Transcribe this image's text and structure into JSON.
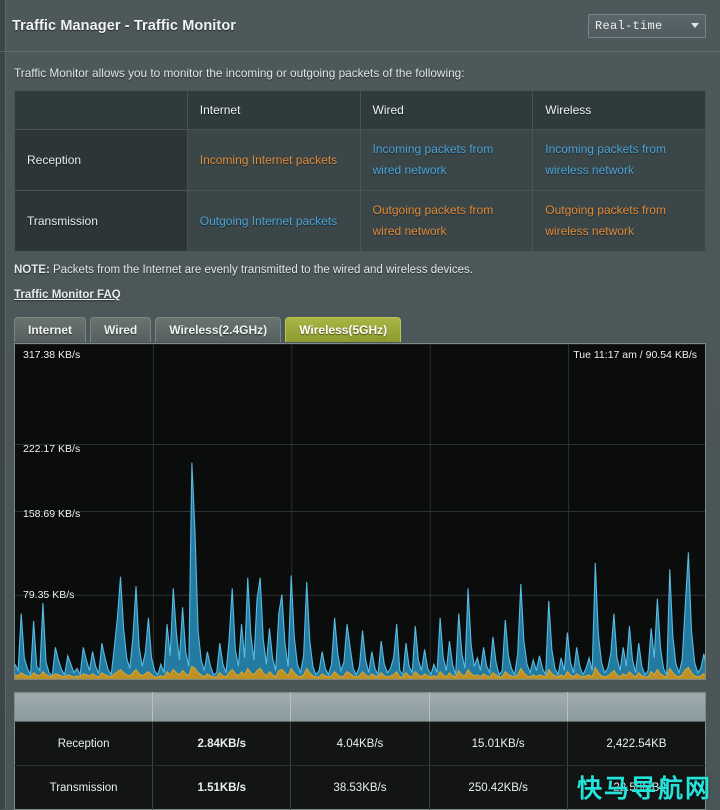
{
  "header": {
    "title": "Traffic Manager - Traffic Monitor",
    "dropdown_value": "Real-time",
    "dropdown_icon": "chevron-down-icon"
  },
  "intro": "Traffic Monitor allows you to monitor the incoming or outgoing packets of the following:",
  "info_table": {
    "columns": [
      "",
      "Internet",
      "Wired",
      "Wireless"
    ],
    "rows": [
      {
        "label": "Reception",
        "cells": [
          {
            "text": "Incoming Internet packets",
            "color": "#e08b39"
          },
          {
            "text": "Incoming packets from wired network",
            "color": "#4ba3d8"
          },
          {
            "text": "Incoming packets from wireless network",
            "color": "#4ba3d8"
          }
        ]
      },
      {
        "label": "Transmission",
        "cells": [
          {
            "text": "Outgoing Internet packets",
            "color": "#4ba3d8"
          },
          {
            "text": "Outgoing packets from wired network",
            "color": "#e08b39"
          },
          {
            "text": "Outgoing packets from wireless network",
            "color": "#e08b39"
          }
        ]
      }
    ]
  },
  "note": {
    "prefix": "NOTE:",
    "text": " Packets from the Internet are evenly transmitted to the wired and wireless devices."
  },
  "faq_link": "Traffic Monitor FAQ",
  "tabs": [
    {
      "label": "Internet",
      "active": false
    },
    {
      "label": "Wired",
      "active": false
    },
    {
      "label": "Wireless(2.4GHz)",
      "active": false
    },
    {
      "label": "Wireless(5GHz)",
      "active": true
    }
  ],
  "chart_data": {
    "type": "area",
    "title": "",
    "status_text": "Tue 11:17 am / 90.54 KB/s",
    "ylabel": "KB/s",
    "xlabel": "",
    "grid": true,
    "legend_position": "none",
    "ylim": [
      0,
      317.38
    ],
    "y_ticks": [
      "317.38 KB/s",
      "222.17 KB/s",
      "158.69 KB/s",
      "79.35 KB/s"
    ],
    "y_tick_values": [
      317.38,
      222.17,
      158.69,
      79.35
    ],
    "vertical_gridlines": 4,
    "colors": {
      "reception_fill": "#2682ab",
      "reception_stroke": "#5fc8ef",
      "transmission_fill": "#c8921f",
      "transmission_stroke": "#e0ad3a",
      "background": "#0b0c0c",
      "gridline": "#2d3132"
    },
    "series": [
      {
        "name": "Reception",
        "color": "#2682ab",
        "values": [
          14,
          8,
          62,
          20,
          10,
          4,
          55,
          12,
          8,
          72,
          16,
          6,
          3,
          30,
          18,
          9,
          4,
          22,
          14,
          6,
          10,
          4,
          30,
          18,
          8,
          26,
          12,
          5,
          34,
          20,
          9,
          4,
          30,
          58,
          97,
          48,
          20,
          10,
          40,
          88,
          30,
          12,
          25,
          58,
          20,
          8,
          4,
          14,
          6,
          52,
          22,
          86,
          44,
          18,
          68,
          26,
          12,
          205,
          140,
          46,
          18,
          8,
          26,
          12,
          4,
          6,
          34,
          14,
          6,
          38,
          86,
          28,
          12,
          52,
          20,
          96,
          42,
          18,
          76,
          96,
          38,
          14,
          48,
          20,
          8,
          62,
          80,
          34,
          12,
          98,
          40,
          14,
          6,
          22,
          92,
          36,
          12,
          4,
          8,
          26,
          10,
          4,
          14,
          58,
          24,
          8,
          16,
          52,
          30,
          10,
          4,
          12,
          46,
          18,
          6,
          26,
          10,
          4,
          36,
          14,
          6,
          10,
          20,
          52,
          8,
          4,
          34,
          12,
          6,
          50,
          18,
          8,
          28,
          10,
          4,
          14,
          6,
          58,
          20,
          8,
          36,
          14,
          4,
          62,
          24,
          10,
          86,
          32,
          12,
          20,
          8,
          30,
          12,
          6,
          40,
          16,
          4,
          8,
          56,
          22,
          10,
          4,
          24,
          90,
          36,
          14,
          6,
          18,
          8,
          22,
          10,
          4,
          74,
          28,
          10,
          4,
          20,
          8,
          44,
          16,
          6,
          30,
          12,
          4,
          10,
          20,
          8,
          110,
          42,
          16,
          6,
          10,
          24,
          62,
          20,
          8,
          30,
          12,
          50,
          18,
          6,
          34,
          12,
          4,
          8,
          48,
          20,
          76,
          30,
          10,
          4,
          104,
          40,
          14,
          6,
          18,
          70,
          120,
          46,
          16,
          6,
          10,
          24,
          8
        ]
      },
      {
        "name": "Transmission",
        "color": "#c8921f",
        "values": [
          4,
          3,
          6,
          4,
          3,
          2,
          6,
          4,
          3,
          7,
          4,
          3,
          2,
          5,
          4,
          3,
          2,
          4,
          3,
          2,
          3,
          2,
          5,
          4,
          3,
          5,
          3,
          2,
          6,
          4,
          3,
          2,
          5,
          7,
          9,
          6,
          4,
          3,
          6,
          9,
          5,
          3,
          5,
          7,
          4,
          2,
          2,
          3,
          2,
          7,
          4,
          9,
          6,
          4,
          8,
          5,
          3,
          12,
          10,
          6,
          4,
          2,
          5,
          3,
          2,
          2,
          6,
          3,
          2,
          6,
          9,
          5,
          3,
          7,
          4,
          10,
          6,
          4,
          8,
          10,
          6,
          3,
          7,
          4,
          2,
          8,
          9,
          6,
          3,
          10,
          6,
          3,
          2,
          4,
          10,
          6,
          3,
          2,
          2,
          5,
          3,
          2,
          3,
          7,
          4,
          2,
          3,
          7,
          5,
          3,
          2,
          3,
          7,
          4,
          2,
          5,
          3,
          2,
          6,
          3,
          2,
          3,
          4,
          7,
          2,
          2,
          6,
          3,
          2,
          7,
          4,
          2,
          5,
          3,
          2,
          3,
          2,
          7,
          4,
          2,
          6,
          3,
          2,
          8,
          4,
          3,
          9,
          5,
          3,
          4,
          2,
          5,
          3,
          2,
          6,
          4,
          2,
          2,
          7,
          4,
          3,
          2,
          4,
          10,
          6,
          3,
          2,
          4,
          2,
          4,
          3,
          2,
          9,
          5,
          3,
          2,
          4,
          2,
          7,
          4,
          2,
          5,
          3,
          2,
          3,
          4,
          2,
          11,
          6,
          3,
          2,
          3,
          5,
          8,
          4,
          2,
          5,
          3,
          7,
          4,
          2,
          6,
          3,
          2,
          2,
          7,
          4,
          9,
          5,
          3,
          2,
          10,
          6,
          3,
          2,
          4,
          9,
          11,
          6,
          3,
          2,
          3,
          5,
          3
        ]
      }
    ]
  },
  "stats_table": {
    "header_cells": [
      "",
      "",
      "",
      "",
      ""
    ],
    "rows": [
      {
        "label": "Reception",
        "values": [
          {
            "text": "2.84KB/s",
            "color": "#f0952f"
          },
          {
            "text": "4.04KB/s",
            "color": "#eceff0"
          },
          {
            "text": "15.01KB/s",
            "color": "#eceff0"
          },
          {
            "text": "2,422.54KB",
            "color": "#eceff0"
          }
        ]
      },
      {
        "label": "Transmission",
        "values": [
          {
            "text": "1.51KB/s",
            "color": "#3ba3e0"
          },
          {
            "text": "38.53KB/s",
            "color": "#eceff0"
          },
          {
            "text": "250.42KB/s",
            "color": "#eceff0"
          },
          {
            "text": "22.58MB",
            "color": "#eceff0"
          }
        ]
      }
    ]
  },
  "watermark": "快马导航网"
}
